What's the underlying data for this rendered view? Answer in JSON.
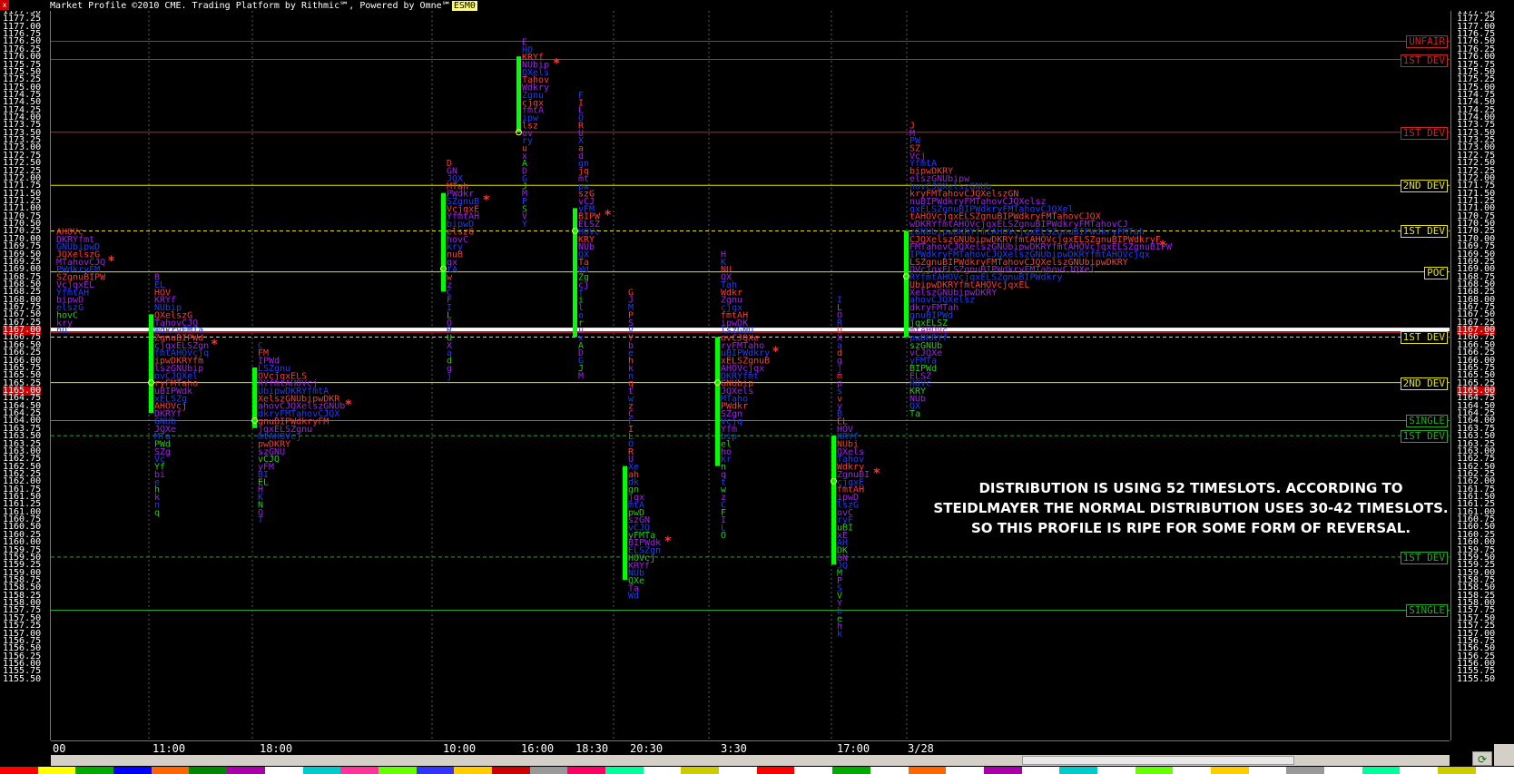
{
  "title_bar": {
    "text": "Market Profile ©2010 CME. Trading Platform by Rithmic℠, Powered by Omne℠",
    "symbol": "ESM0"
  },
  "price_axis": {
    "min": 1155.5,
    "max": 1177.5,
    "step": 0.25,
    "highlighted": [
      "1167.00",
      "1165.00"
    ]
  },
  "time_axis": [
    "00",
    "11:00",
    "18:00",
    "10:00",
    "16:00",
    "18:30",
    "20:30",
    "3:30",
    "17:00",
    "3/28"
  ],
  "reference_levels": [
    {
      "label": "UNFAIR",
      "price": 1176.5,
      "color": "#cc2222",
      "style": "solid"
    },
    {
      "label": "1ST DEV",
      "price": 1175.9,
      "color": "#cc2222",
      "style": "solid"
    },
    {
      "label": "1ST DEV",
      "price": 1173.5,
      "color": "#cc2222",
      "style": "solid"
    },
    {
      "label": "2ND DEV",
      "price": 1171.75,
      "color": "#e6e600",
      "style": "solid"
    },
    {
      "label": "1ST DEV",
      "price": 1170.25,
      "color": "#e6e600",
      "style": "dashed"
    },
    {
      "label": "POC",
      "price": 1168.9,
      "color": "#e6e600",
      "style": "solid"
    },
    {
      "label": "1ST DEV",
      "price": 1166.75,
      "color": "#e6e600",
      "style": "dashed"
    },
    {
      "label": "2ND DEV",
      "price": 1165.25,
      "color": "#e6e600",
      "style": "solid"
    },
    {
      "label": "SINGLE",
      "price": 1164.0,
      "color": "#22aa22",
      "style": "solid"
    },
    {
      "label": "1ST DEV",
      "price": 1163.5,
      "color": "#22aa22",
      "style": "dashed"
    },
    {
      "label": "1ST DEV",
      "price": 1159.5,
      "color": "#22aa22",
      "style": "dashed"
    },
    {
      "label": "SINGLE",
      "price": 1157.75,
      "color": "#22aa22",
      "style": "solid"
    }
  ],
  "current_price": 1167.0,
  "annotation": [
    "DISTRIBUTION IS USING 52 TIMESLOTS. ACCORDING TO",
    "STEIDLMAYER THE NORMAL DISTRIBUTION USES 30-42 TIMESLOTS.",
    "SO THIS PROFILE IS RIPE FOR SOME FORM OF REVERSAL."
  ],
  "profiles": [
    {
      "hi": 1170.25,
      "lo": 1166.75,
      "ib_hi": null,
      "ib_lo": null,
      "ib_mid": null,
      "shape": [
        5,
        7,
        8,
        8,
        9,
        8,
        9,
        7,
        6,
        5,
        5,
        4,
        3,
        2
      ],
      "poc_star": true
    },
    {
      "hi": 1168.75,
      "lo": 1160.75,
      "ib_hi": 1167.5,
      "ib_lo": 1164.25,
      "ib_mid": 1165.25,
      "shape": [
        1,
        2,
        3,
        4,
        5,
        7,
        8,
        9,
        9,
        10,
        10,
        9,
        9,
        8,
        8,
        7,
        6,
        6,
        5,
        4,
        4,
        3,
        3,
        3,
        2,
        2,
        2,
        1,
        1,
        1,
        1,
        1
      ],
      "poc_star": true
    },
    {
      "hi": 1166.5,
      "lo": 1160.75,
      "ib_hi": 1165.75,
      "ib_lo": 1163.75,
      "ib_mid": 1164.0,
      "shape": [
        1,
        2,
        4,
        6,
        9,
        11,
        13,
        15,
        16,
        15,
        13,
        10,
        8,
        6,
        5,
        4,
        3,
        2,
        2,
        1,
        1,
        1,
        1,
        1
      ],
      "poc_star": true
    },
    {
      "hi": 1172.5,
      "lo": 1165.5,
      "ib_hi": 1171.5,
      "ib_lo": 1168.25,
      "ib_mid": 1169.0,
      "shape": [
        1,
        2,
        3,
        4,
        5,
        6,
        6,
        6,
        5,
        5,
        4,
        3,
        3,
        2,
        2,
        1,
        1,
        1,
        1,
        1,
        1,
        1,
        1,
        1,
        1,
        1,
        1,
        1,
        1
      ],
      "poc_star": true
    },
    {
      "hi": 1176.5,
      "lo": 1170.5,
      "ib_hi": 1176.0,
      "ib_lo": 1173.5,
      "ib_mid": 1173.5,
      "shape": [
        1,
        2,
        4,
        5,
        5,
        5,
        5,
        4,
        4,
        4,
        3,
        3,
        2,
        2,
        1,
        1,
        1,
        1,
        1,
        1,
        1,
        1,
        1,
        1,
        1
      ],
      "poc_star": true
    },
    {
      "hi": 1174.75,
      "lo": 1165.5,
      "ib_hi": 1171.0,
      "ib_lo": 1166.75,
      "ib_mid": 1170.25,
      "shape": [
        1,
        1,
        1,
        1,
        1,
        1,
        1,
        1,
        1,
        2,
        2,
        2,
        2,
        3,
        3,
        3,
        4,
        4,
        4,
        3,
        3,
        2,
        2,
        2,
        2,
        2,
        1,
        1,
        1,
        1,
        1,
        1,
        1,
        1,
        1,
        1,
        1,
        1
      ],
      "poc_star": true
    },
    {
      "hi": 1168.25,
      "lo": 1158.0,
      "ib_hi": 1162.5,
      "ib_lo": 1158.75,
      "ib_mid": null,
      "shape": [
        1,
        1,
        1,
        1,
        1,
        1,
        1,
        1,
        1,
        1,
        1,
        1,
        1,
        1,
        1,
        1,
        1,
        1,
        1,
        1,
        1,
        1,
        1,
        2,
        2,
        2,
        2,
        3,
        3,
        3,
        4,
        4,
        5,
        6,
        6,
        5,
        4,
        3,
        3,
        2,
        2
      ],
      "poc_star": true
    },
    {
      "hi": 1169.5,
      "lo": 1160.0,
      "ib_hi": 1166.75,
      "ib_lo": 1162.5,
      "ib_mid": 1165.25,
      "shape": [
        1,
        1,
        2,
        2,
        3,
        4,
        4,
        4,
        5,
        5,
        6,
        7,
        8,
        9,
        9,
        8,
        7,
        6,
        6,
        5,
        5,
        4,
        4,
        3,
        3,
        2,
        2,
        2,
        1,
        1,
        1,
        1,
        1,
        1,
        1,
        1,
        1,
        1
      ],
      "poc_star": true
    },
    {
      "hi": 1168.0,
      "lo": 1156.75,
      "ib_hi": 1163.5,
      "ib_lo": 1159.25,
      "ib_mid": 1162.0,
      "shape": [
        1,
        1,
        1,
        1,
        1,
        1,
        1,
        1,
        1,
        1,
        1,
        1,
        1,
        1,
        1,
        1,
        2,
        3,
        4,
        4,
        5,
        5,
        5,
        6,
        5,
        5,
        4,
        4,
        3,
        3,
        3,
        2,
        2,
        2,
        2,
        2,
        1,
        1,
        1,
        1,
        1,
        1,
        1,
        1,
        1
      ],
      "poc_star": true
    },
    {
      "hi": 1173.75,
      "lo": 1164.25,
      "ib_hi": 1170.25,
      "ib_lo": 1166.75,
      "ib_mid": 1168.75,
      "shape": [
        1,
        1,
        2,
        2,
        3,
        5,
        8,
        11,
        15,
        20,
        25,
        30,
        35,
        40,
        43,
        46,
        48,
        44,
        40,
        34,
        28,
        22,
        16,
        12,
        9,
        8,
        7,
        7,
        7,
        6,
        6,
        5,
        5,
        4,
        4,
        3,
        3,
        2,
        2
      ],
      "poc_star": true
    }
  ],
  "profile_anchors": [
    0,
    108,
    222,
    430,
    513,
    575,
    630,
    732,
    860,
    940
  ],
  "colors": {
    "up": "#ff3a3a",
    "mid": "#a020f0",
    "dn": "#1e3cff",
    "ib": "#00ff00",
    "dn2": "#22cc22",
    "orange": "#ff5a1a"
  }
}
